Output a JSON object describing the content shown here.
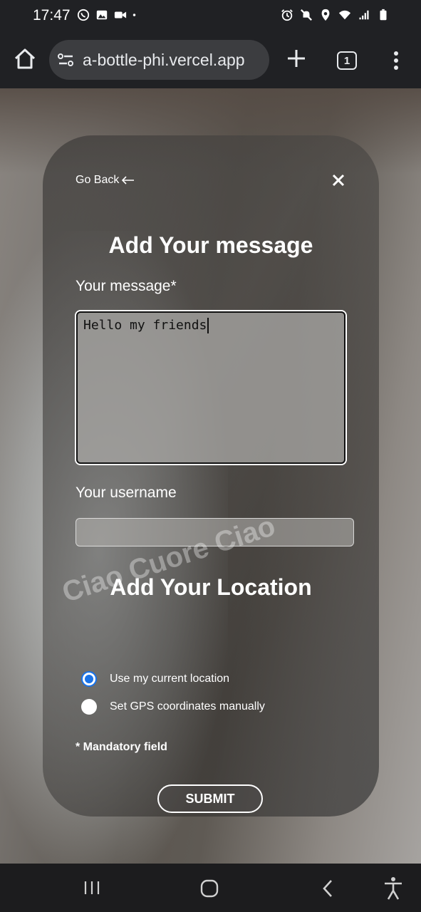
{
  "status_bar": {
    "time": "17:47",
    "left_icons": [
      "whatsapp-icon",
      "gallery-icon",
      "video-icon",
      "dot-icon"
    ],
    "right_icons": [
      "alarm-icon",
      "mute-icon",
      "location-icon",
      "wifi-icon",
      "signal-icon",
      "battery-icon"
    ]
  },
  "browser": {
    "url": "a-bottle-phi.vercel.app",
    "tab_count": "1"
  },
  "form": {
    "go_back": "Go Back",
    "title": "Add Your message",
    "message_label": "Your message*",
    "message_value": "Hello my friends",
    "username_label": "Your username",
    "username_value": "",
    "location_title": "Add Your Location",
    "watermark": "Ciao Cuore Ciao",
    "location_options": [
      {
        "label": "Use my current location",
        "checked": true
      },
      {
        "label": "Set GPS coordinates manually",
        "checked": false
      }
    ],
    "mandatory_note": "* Mandatory field",
    "submit_label": "SUBMIT"
  },
  "colors": {
    "radio_accent": "#1a73e8",
    "chrome_bg": "#202124"
  }
}
